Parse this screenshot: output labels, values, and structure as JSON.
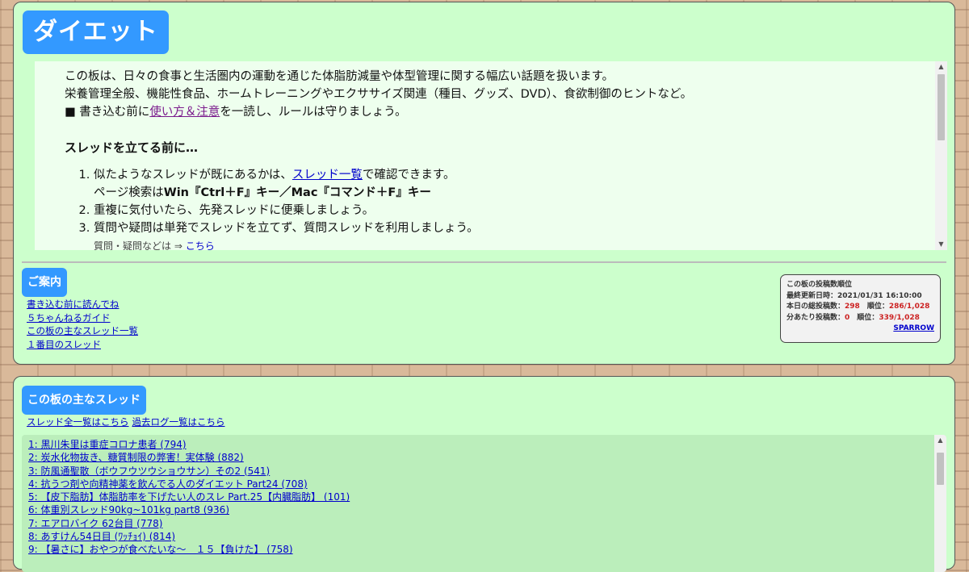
{
  "board": {
    "title": "ダイエット"
  },
  "description": {
    "line1": "この板は、日々の食事と生活圏内の運動を通じた体脂肪減量や体型管理に関する幅広い話題を扱います。",
    "line2": "栄養管理全般、機能性食品、ホームトレーニングやエクササイズ関連（種目、グッズ、DVD）、食欲制御のヒントなど。",
    "line3_pre": "■ 書き込む前に",
    "line3_link": "使い方＆注意",
    "line3_post": "を一読し、ルールは守りましょう。",
    "heading": "スレッドを立てる前に…",
    "item1_pre": "似たようなスレッドが既にあるかは、",
    "item1_link": "スレッド一覧",
    "item1_post": "で確認できます。",
    "item1_sub_pre": "ページ検索は",
    "item1_sub_bold": "Win『Ctrl＋F』キー／Mac『コマンド＋F』キー",
    "item2": "重複に気付いたら、先発スレッドに便乗しましょう。",
    "item3": "質問や疑問は単発でスレッドを立てず、質問スレッドを利用しましょう。",
    "item3_sub_pre": "質問・疑問などは ⇒ ",
    "item3_sub_link": "こちら"
  },
  "guide": {
    "heading": "ご案内",
    "links": [
      "書き込む前に読んでね",
      "５ちゃんねるガイド",
      "この板の主なスレッド一覧",
      "１番目のスレッド"
    ]
  },
  "ranking": {
    "title": "この板の投稿数順位",
    "updated_label": "最終更新日時：",
    "updated_value": "2021/01/31 16:10:00",
    "today_label": "本日の総投稿数：",
    "today_value": "298",
    "rank_label": "順位：",
    "today_rank": "286/1,028",
    "per_min_label": "分あたり投稿数：",
    "per_min_value": "0",
    "per_min_rank": "339/1,028",
    "link": "SPARROW"
  },
  "threads": {
    "heading": "この板の主なスレッド",
    "all_link": "スレッド全一覧はこちら",
    "log_link": "過去ログ一覧はこちら",
    "items": [
      "1: 黒川朱里は重症コロナ患者 (794)",
      "2: 炭水化物抜き、糖質制限の弊害！実体験 (882)",
      "3: 防風通聖散（ボウフウツウショウサン）その2 (541)",
      "4: 抗うつ剤や向精神薬を飲んでる人のダイエット Part24 (708)",
      "5: 【皮下脂肪】体脂肪率を下げたい人のスレ Part.25【内臓脂肪】 (101)",
      "6: 体重別スレッド90kg~101kg part8 (936)",
      "7: エアロバイク 62台目 (778)",
      "8: あすけん54日目 (ﾜｯﾁｮｲ) (814)",
      "9: 【暑さに】おやつが食べたいな～　１５【負けた】 (758)"
    ]
  }
}
